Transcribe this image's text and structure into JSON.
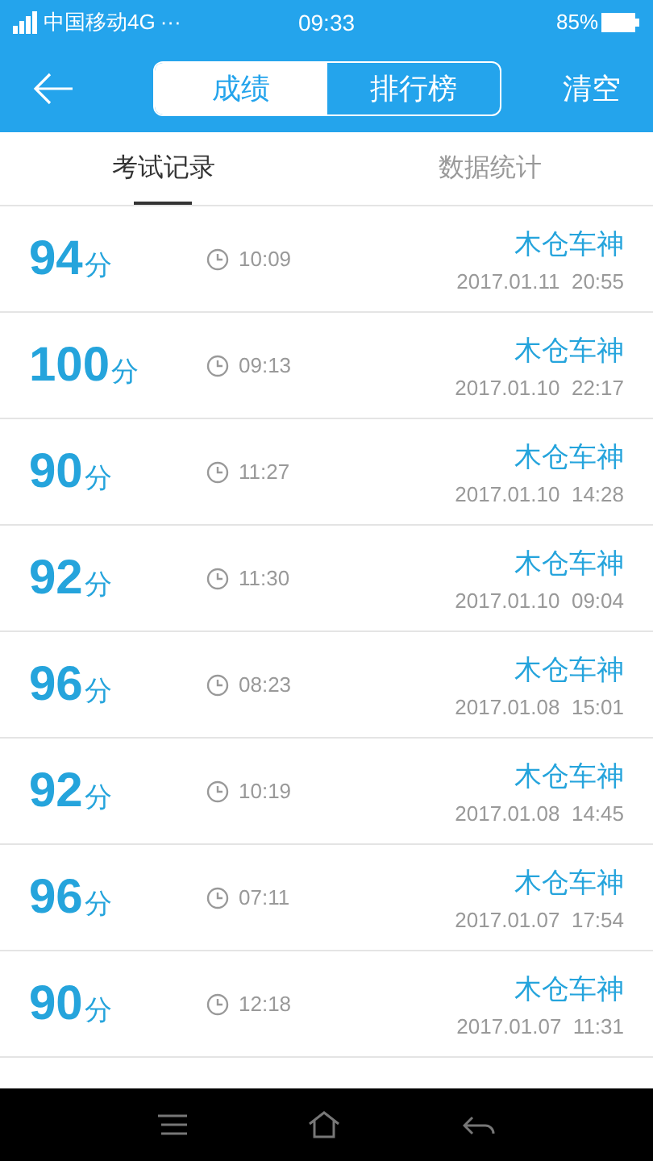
{
  "status_bar": {
    "carrier": "中国移动4G",
    "more": "···",
    "time": "09:33",
    "battery": "85%"
  },
  "header": {
    "segments": [
      {
        "label": "成绩",
        "selected": true
      },
      {
        "label": "排行榜",
        "selected": false
      }
    ],
    "action": "清空"
  },
  "tabs": [
    {
      "label": "考试记录",
      "selected": true
    },
    {
      "label": "数据统计",
      "selected": false
    }
  ],
  "records": [
    {
      "score": "94",
      "unit": "分",
      "duration": "10:09",
      "name": "木仓车神",
      "date": "2017.01.11  20:55"
    },
    {
      "score": "100",
      "unit": "分",
      "duration": "09:13",
      "name": "木仓车神",
      "date": "2017.01.10  22:17"
    },
    {
      "score": "90",
      "unit": "分",
      "duration": "11:27",
      "name": "木仓车神",
      "date": "2017.01.10  14:28"
    },
    {
      "score": "92",
      "unit": "分",
      "duration": "11:30",
      "name": "木仓车神",
      "date": "2017.01.10  09:04"
    },
    {
      "score": "96",
      "unit": "分",
      "duration": "08:23",
      "name": "木仓车神",
      "date": "2017.01.08  15:01"
    },
    {
      "score": "92",
      "unit": "分",
      "duration": "10:19",
      "name": "木仓车神",
      "date": "2017.01.08  14:45"
    },
    {
      "score": "96",
      "unit": "分",
      "duration": "07:11",
      "name": "木仓车神",
      "date": "2017.01.07  17:54"
    },
    {
      "score": "90",
      "unit": "分",
      "duration": "12:18",
      "name": "木仓车神",
      "date": "2017.01.07  11:31"
    }
  ]
}
